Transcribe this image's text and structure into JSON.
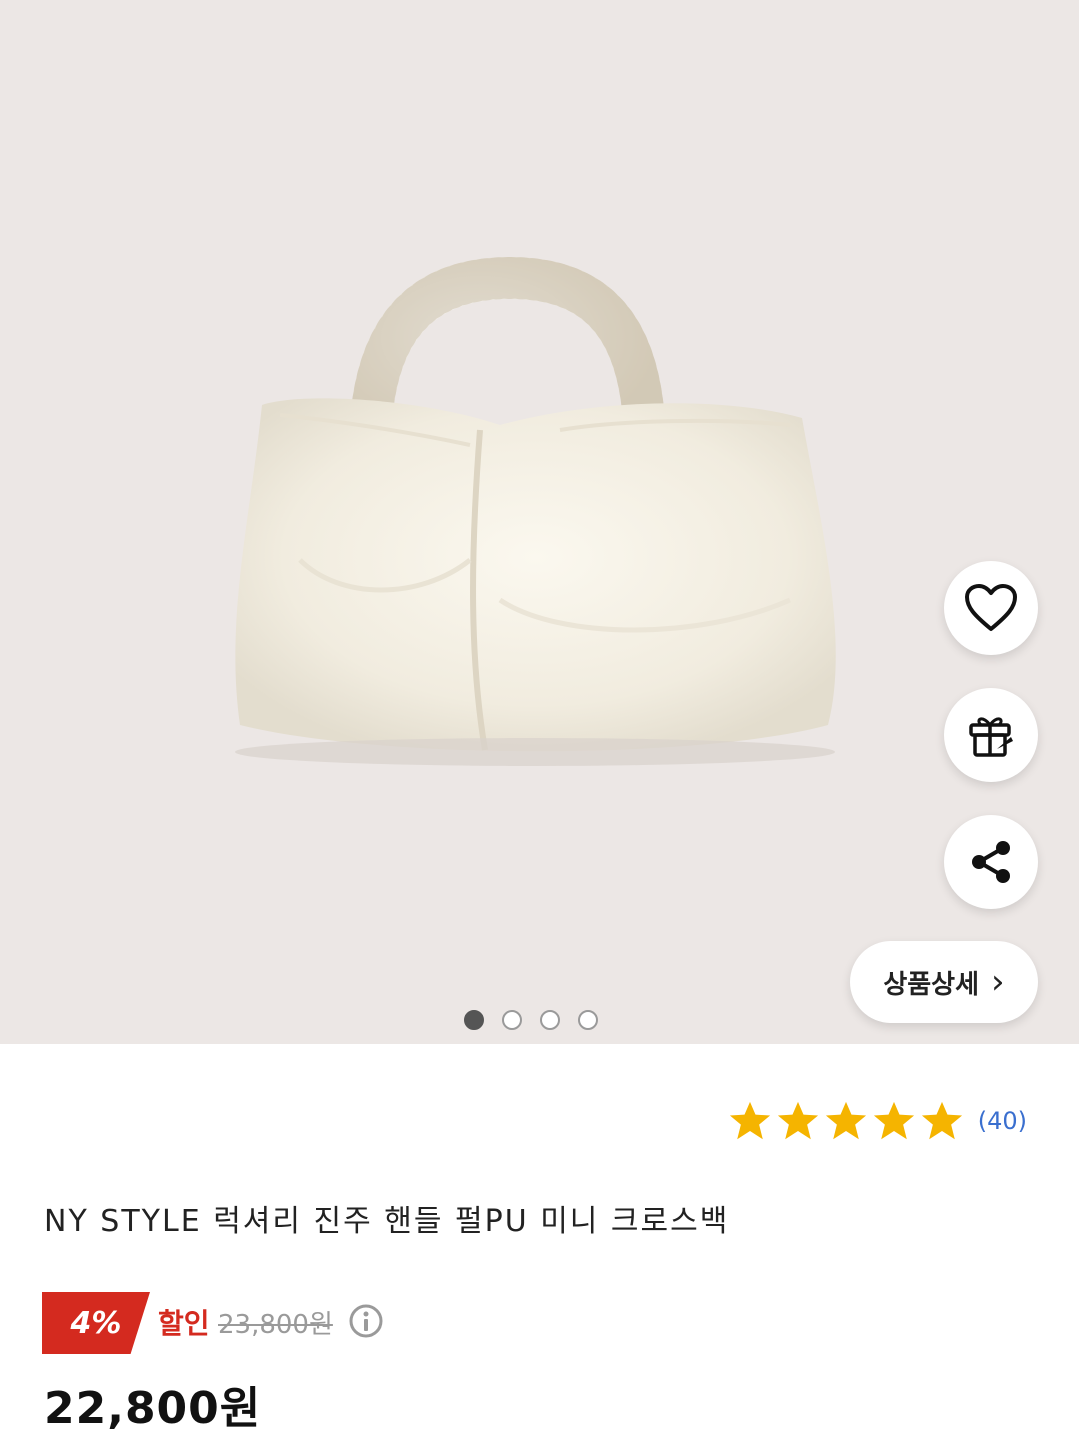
{
  "product_image": {
    "alt_icon": "pearl-handle-bag-image",
    "carousel": {
      "total": 4,
      "active_index": 0
    }
  },
  "actions": {
    "wishlist_icon": "heart-icon",
    "gift_icon": "gift-icon",
    "share_icon": "share-icon",
    "detail_label": "상품상세",
    "detail_chevron": "›"
  },
  "rating": {
    "stars": 5,
    "count_text": "(40)"
  },
  "product": {
    "title": "NY STYLE 럭셔리 진주 핸들 펄PU 미니 크로스백",
    "discount_badge": "4%",
    "discount_label": "할인",
    "original_price": "23,800원",
    "price": "22,800원"
  },
  "colors": {
    "accent_red": "#d42a1f",
    "star_yellow": "#f5b400",
    "link_blue": "#3a6fcf",
    "hero_bg": "#ece7e5"
  }
}
